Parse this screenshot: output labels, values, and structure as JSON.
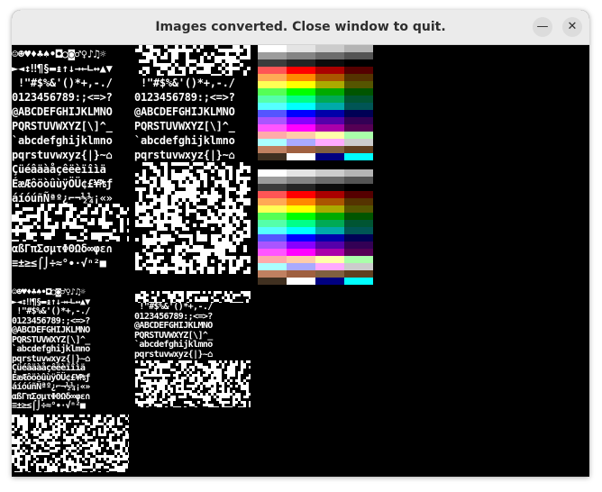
{
  "window": {
    "title": "Images converted. Close window to quit.",
    "minimize_glyph": "—",
    "close_glyph": "✕"
  },
  "font_sheets": {
    "large_left": [
      "☺☻♥♦♣♠•◘○◙♂♀♪♫☼",
      "►◄↕‼¶§▬↨↑↓→←∟↔▲▼",
      " !\"#$%&'()*+,-./",
      "0123456789:;<=>?",
      "@ABCDEFGHIJKLMNO",
      "PQRSTUVWXYZ[\\]^_",
      "`abcdefghijklmno",
      "pqrstuvwxyz{|}~⌂",
      "Çüéâäàåçêëèïîìä",
      "ÉæÆôöòûùÿÖÜ¢£¥₧ƒ",
      "áíóúñÑªº¿⌐¬½¼¡«»"
    ],
    "large_right": [
      " !\"#$%&'()*+,-./",
      "0123456789:;<=>?",
      "@ABCDEFGHIJKLMNO",
      "PQRSTUVWXYZ[\\]^_",
      "`abcdefghijklmno",
      "pqrstuvwxyz{|}~⌂"
    ],
    "large_left_bottom": [
      "αßΓπΣσµτΦΘΩδ∞φε∩",
      "≡±≥≤⌠⌡÷≈°∙·√ⁿ²■ "
    ],
    "small_left": [
      "☺☻♥♦♣♠•◘○◙♂♀♪♫☼",
      "►◄↕‼¶§▬↨↑↓→←∟↔▲▼",
      " !\"#$%&'()*+,-./",
      "0123456789:;<=>?",
      "@ABCDEFGHIJKLMNO",
      "PQRSTUVWXYZ[\\]^_",
      "`abcdefghijklmno",
      "pqrstuvwxyz{|}~⌂",
      "Çüéâäàåçêëèïîìä",
      "ÉæÆôöòûùÿÖÜ¢£¥₧ƒ",
      "áíóúñÑªº¿⌐¬½¼¡«»",
      "αßΓπΣσµτΦΘΩδ∞φε∩",
      "≡±≥≤⌠⌡÷≈°∙·√ⁿ²■ "
    ],
    "small_right": [
      " !\"#$%&'()*+,-./",
      "0123456789:;<=>?",
      "@ABCDEFGHIJKLMNO",
      "PQRSTUVWXYZ[\\]^_",
      "`abcdefghijklmno",
      "pqrstuvwxyz{|}~⌂"
    ]
  },
  "palette_colors": [
    "#ffffff",
    "#e4e4e4",
    "#cccccc",
    "#b4b4b4",
    "#9c9c9c",
    "#848484",
    "#6c6c6c",
    "#545454",
    "#3c3c3c",
    "#242424",
    "#0c0c0c",
    "#000000",
    "#ff5555",
    "#ff0000",
    "#aa0000",
    "#550000",
    "#ffaa55",
    "#ff8800",
    "#aa5500",
    "#553300",
    "#ffff55",
    "#ffff00",
    "#aaaa00",
    "#555500",
    "#55ff55",
    "#00ff00",
    "#00aa00",
    "#005500",
    "#55ffaa",
    "#00ff88",
    "#00aa55",
    "#005533",
    "#55ffff",
    "#00ffff",
    "#00aaaa",
    "#005555",
    "#5555ff",
    "#0000ff",
    "#0000aa",
    "#000055",
    "#aa55ff",
    "#8800ff",
    "#5500aa",
    "#330055",
    "#ff55ff",
    "#ff00ff",
    "#aa00aa",
    "#550055",
    "#ffaaaa",
    "#ffccaa",
    "#ffffaa",
    "#aaffaa",
    "#aaffff",
    "#aaaaff",
    "#ffaaff",
    "#cccccc",
    "#c08060",
    "#a06040",
    "#806040",
    "#604020",
    "#403020",
    "#ffffff",
    "#000080",
    "#00ffff"
  ]
}
